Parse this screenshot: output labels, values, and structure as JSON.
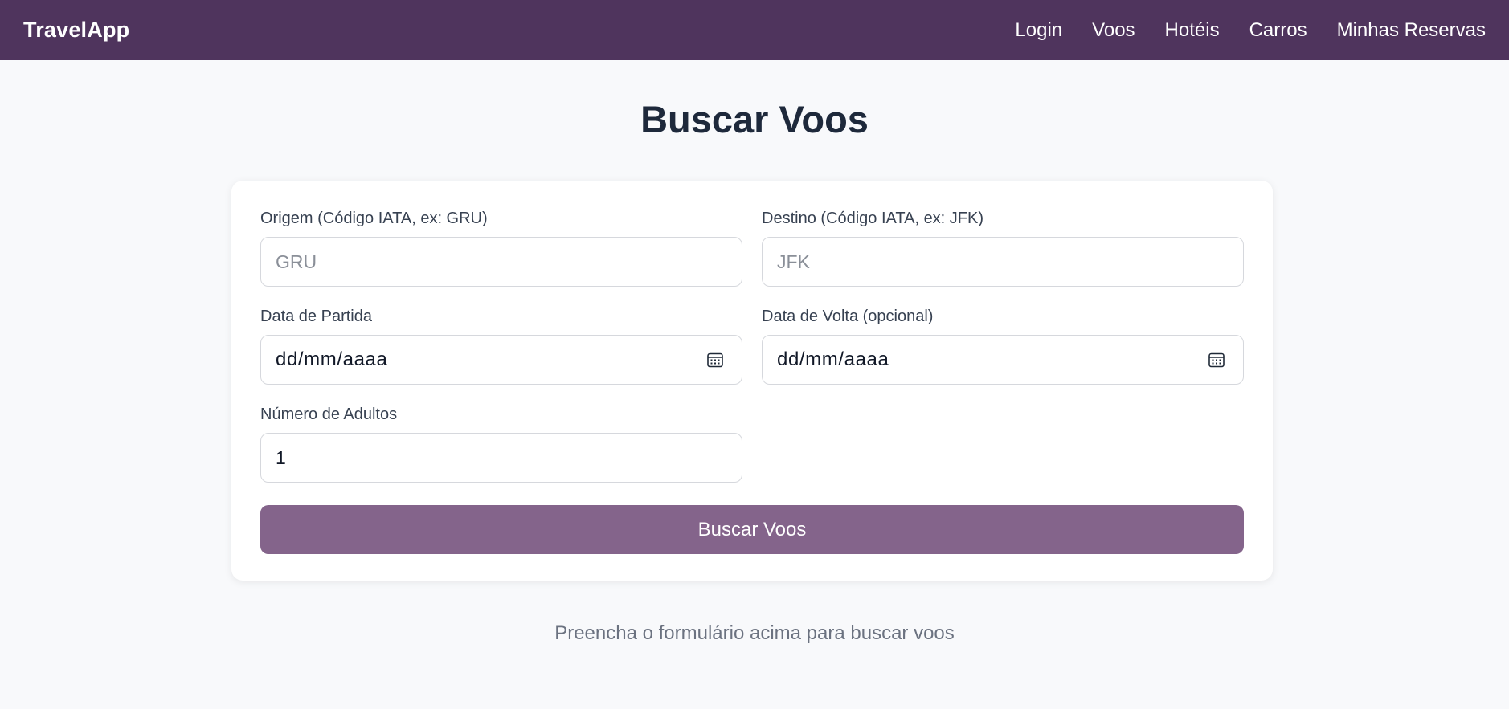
{
  "app": {
    "brand": "TravelApp"
  },
  "nav": {
    "items": [
      {
        "label": "Login"
      },
      {
        "label": "Voos"
      },
      {
        "label": "Hotéis"
      },
      {
        "label": "Carros"
      },
      {
        "label": "Minhas Reservas"
      }
    ]
  },
  "page": {
    "title": "Buscar Voos"
  },
  "form": {
    "origin": {
      "label": "Origem (Código IATA, ex: GRU)",
      "placeholder": "GRU",
      "value": ""
    },
    "destination": {
      "label": "Destino (Código IATA, ex: JFK)",
      "placeholder": "JFK",
      "value": ""
    },
    "departure": {
      "label": "Data de Partida",
      "display": "dd/mm/aaaa",
      "icon": "calendar-icon"
    },
    "return": {
      "label": "Data de Volta (opcional)",
      "display": "dd/mm/aaaa",
      "icon": "calendar-icon"
    },
    "adults": {
      "label": "Número de Adultos",
      "value": "1"
    },
    "submit_label": "Buscar Voos"
  },
  "hint": "Preencha o formulário acima para buscar voos",
  "colors": {
    "navbar": "#4f345d",
    "button": "#84648b",
    "background": "#f8f9fb",
    "card": "#ffffff"
  }
}
